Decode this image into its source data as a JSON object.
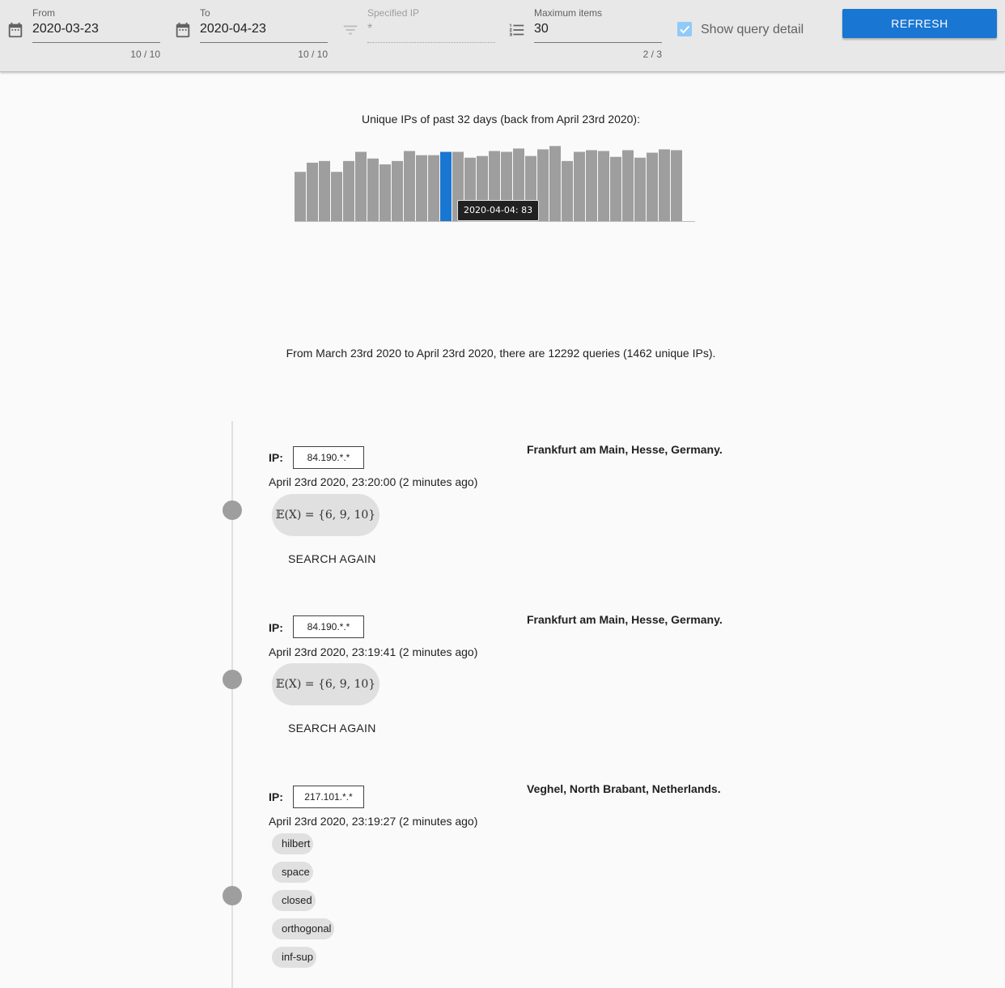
{
  "toolbar": {
    "from": {
      "label": "From",
      "value": "2020-03-23",
      "counter": "10 / 10",
      "icon": "calendar-icon"
    },
    "to": {
      "label": "To",
      "value": "2020-04-23",
      "counter": "10 / 10",
      "icon": "calendar-icon"
    },
    "ip": {
      "label": "Specified IP",
      "value": "*",
      "icon": "filter-icon"
    },
    "max": {
      "label": "Maximum items",
      "value": "30",
      "counter": "2 / 3",
      "icon": "list-numbered-icon"
    },
    "show_detail": {
      "label": "Show query detail",
      "checked": true
    },
    "refresh_label": "Refresh"
  },
  "colors": {
    "accent": "#1976d2",
    "bar": "#9e9e9e",
    "highlight": "#1976d2"
  },
  "chart_title": "Unique IPs of past 32 days (back from April 23rd 2020):",
  "chart_data": {
    "type": "bar",
    "highlight_index": 12,
    "ylim": [
      0,
      100
    ],
    "values": [
      59,
      70,
      72,
      59,
      72,
      83,
      75,
      68,
      72,
      84,
      79,
      79,
      83,
      83,
      76,
      78,
      84,
      83,
      87,
      78,
      86,
      90,
      72,
      83,
      85,
      84,
      77,
      85,
      76,
      82,
      86,
      85,
      0
    ],
    "tooltip": "2020-04-04: 83"
  },
  "summary": "From March 23rd 2020 to April 23rd 2020, there are 12292 queries (1462 unique IPs).",
  "entries": [
    {
      "ip_label": "IP:",
      "ip": "84.190.*.*",
      "timestamp": "April 23rd 2020, 23:20:00 (2 minutes ago)",
      "location": "Frankfurt am Main, Hesse, Germany.",
      "query": "𝔼(X) = {6, 9, 10}",
      "search_again": "Search again"
    },
    {
      "ip_label": "IP:",
      "ip": "84.190.*.*",
      "timestamp": "April 23rd 2020, 23:19:41 (2 minutes ago)",
      "location": "Frankfurt am Main, Hesse, Germany.",
      "query": "𝔼(X) = {6, 9, 10}",
      "search_again": "Search again"
    },
    {
      "ip_label": "IP:",
      "ip": "217.101.*.*",
      "timestamp": "April 23rd 2020, 23:19:27 (2 minutes ago)",
      "location": "Veghel, North Brabant, Netherlands.",
      "keywords": [
        "hilbert",
        "space",
        "closed",
        "orthogonal",
        "inf-sup"
      ]
    }
  ]
}
